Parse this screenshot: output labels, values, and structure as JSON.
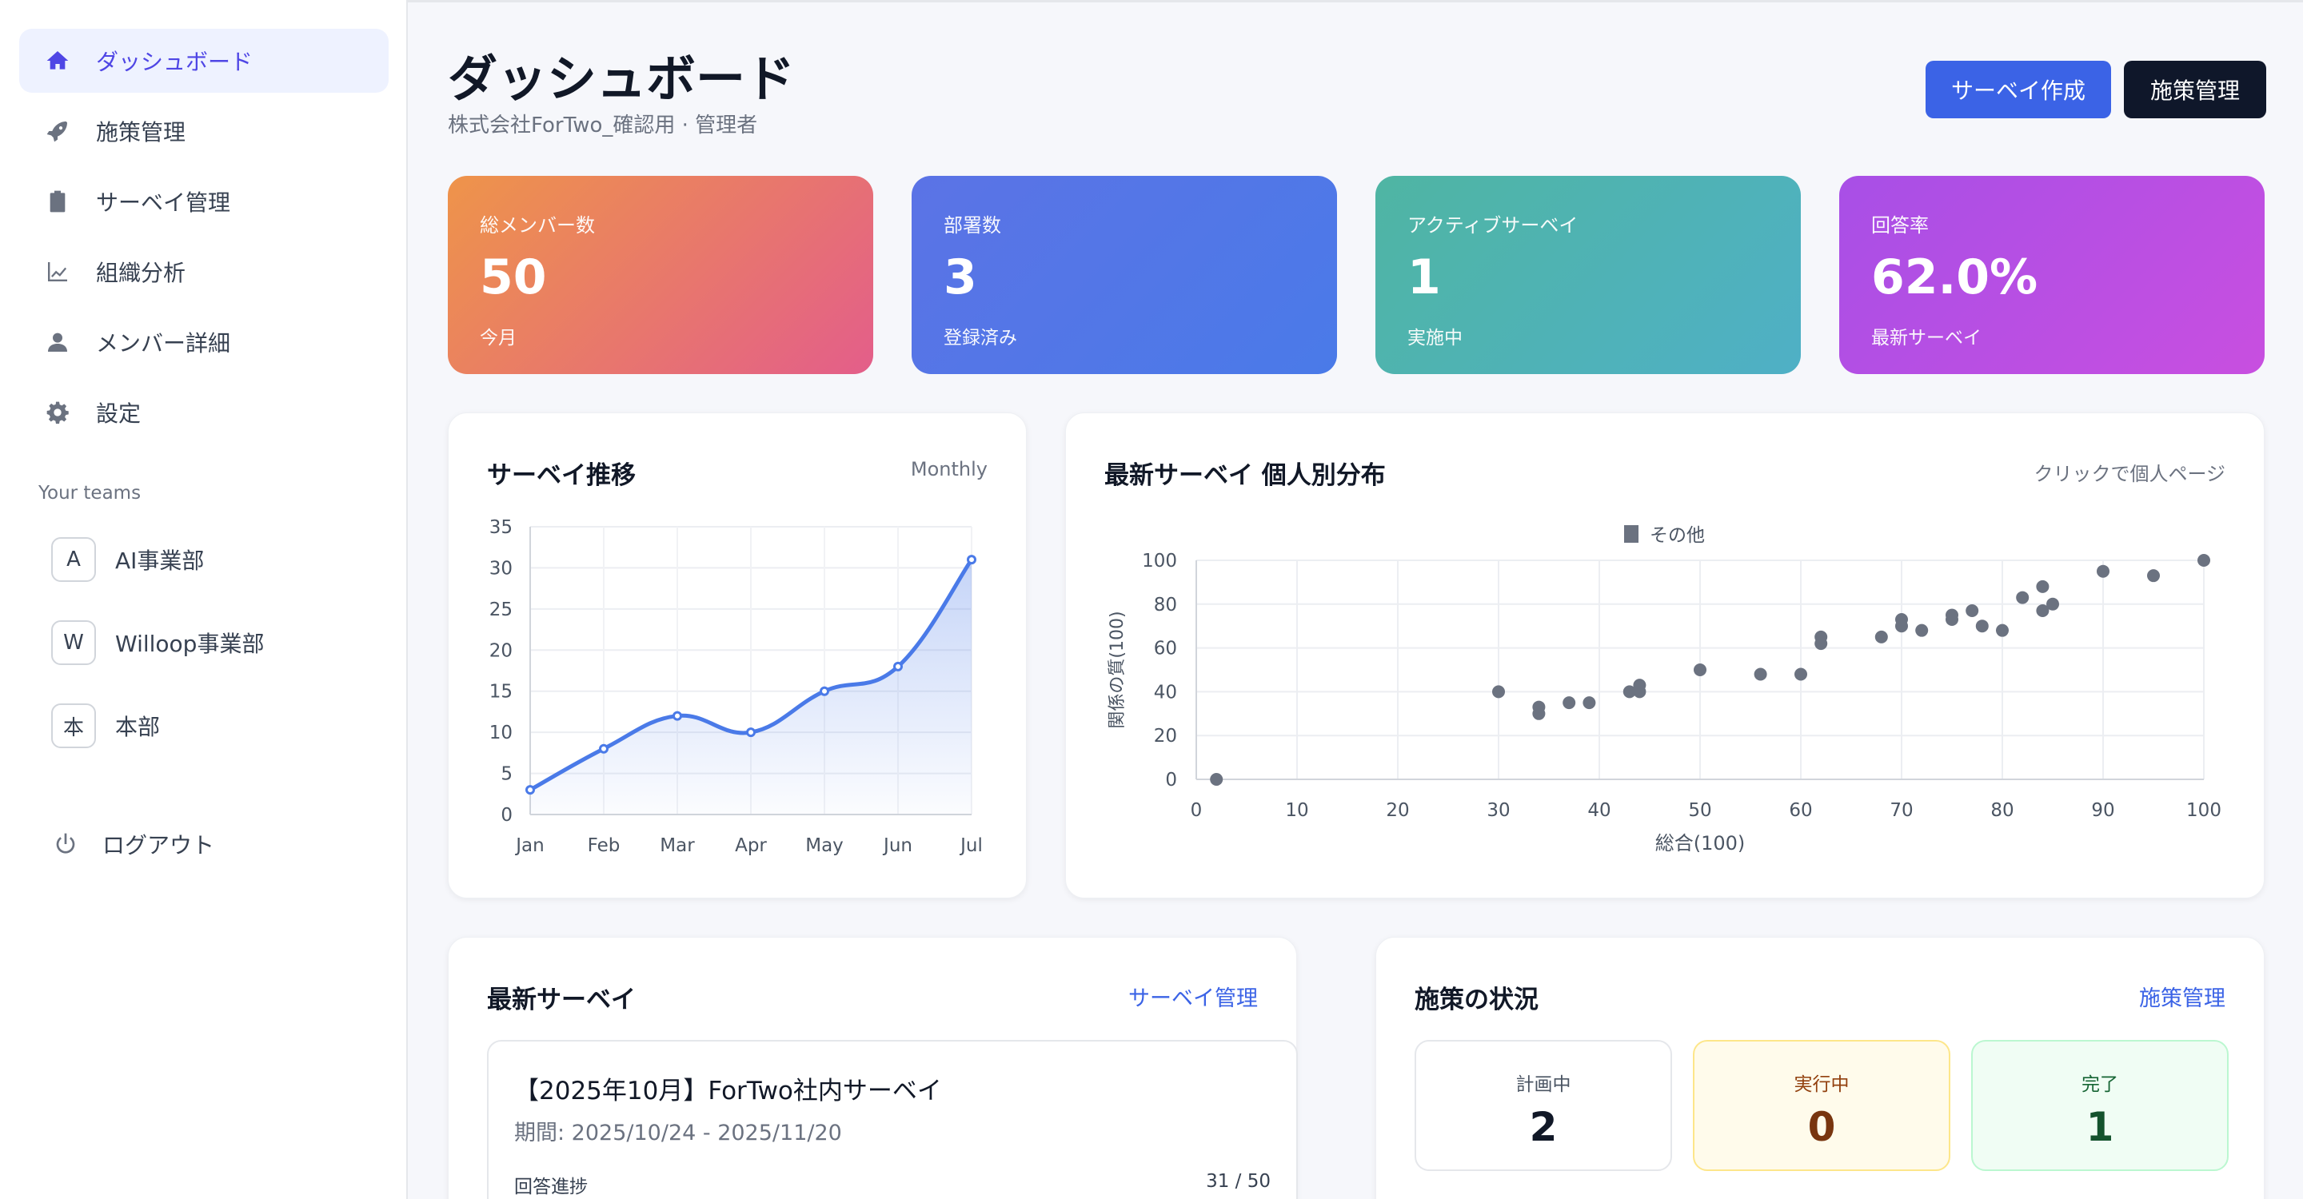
{
  "sidebar": {
    "items": [
      {
        "label": "ダッシュボード",
        "icon": "home-icon"
      },
      {
        "label": "施策管理",
        "icon": "rocket-icon"
      },
      {
        "label": "サーベイ管理",
        "icon": "clipboard-icon"
      },
      {
        "label": "組織分析",
        "icon": "line-chart-icon"
      },
      {
        "label": "メンバー詳細",
        "icon": "user-icon"
      },
      {
        "label": "設定",
        "icon": "gear-icon"
      }
    ],
    "teams_title": "Your teams",
    "teams": [
      {
        "badge": "A",
        "name": "AI事業部"
      },
      {
        "badge": "W",
        "name": "Willoop事業部"
      },
      {
        "badge": "本",
        "name": "本部"
      }
    ],
    "logout_label": "ログアウト"
  },
  "header": {
    "title": "ダッシュボード",
    "subtitle": "株式会社ForTwo_確認用 · 管理者",
    "create_survey_label": "サーベイ作成",
    "measures_label": "施策管理"
  },
  "stats": [
    {
      "label": "総メンバー数",
      "value": "50",
      "sub": "今月"
    },
    {
      "label": "部署数",
      "value": "3",
      "sub": "登録済み"
    },
    {
      "label": "アクティブサーベイ",
      "value": "1",
      "sub": "実施中"
    },
    {
      "label": "回答率",
      "value": "62.0%",
      "sub": "最新サーベイ"
    }
  ],
  "trend_panel": {
    "title": "サーベイ推移",
    "period": "Monthly"
  },
  "scatter_panel": {
    "title": "最新サーベイ 個人別分布",
    "hint": "クリックで個人ページ"
  },
  "survey_panel": {
    "title": "最新サーベイ",
    "link": "サーベイ管理",
    "survey_name": "【2025年10月】ForTwo社内サーベイ",
    "period": "期間: 2025/10/24 - 2025/11/20",
    "progress_label": "回答進捗",
    "progress_count": "31 / 50",
    "progress_fraction": 0.62
  },
  "status_panel": {
    "title": "施策の状況",
    "link": "施策管理",
    "boxes": [
      {
        "label": "計画中",
        "value": "2"
      },
      {
        "label": "実行中",
        "value": "0"
      },
      {
        "label": "完了",
        "value": "1"
      }
    ]
  },
  "chart_data": [
    {
      "type": "line",
      "title": "サーベイ推移",
      "categories": [
        "Jan",
        "Feb",
        "Mar",
        "Apr",
        "May",
        "Jun",
        "Jul"
      ],
      "values": [
        3,
        8,
        12,
        10,
        15,
        18,
        31
      ],
      "ylim": [
        0,
        35
      ],
      "yticks": [
        "0",
        "5",
        "10",
        "15",
        "20",
        "25",
        "30",
        "35"
      ],
      "grid": true,
      "color": "#4a7ae8"
    },
    {
      "type": "scatter",
      "title": "最新サーベイ 個人別分布",
      "xlabel": "総合(100)",
      "ylabel": "関係の質(100)",
      "xlim": [
        0,
        100
      ],
      "ylim": [
        0,
        100
      ],
      "xticks": [
        "0",
        "10",
        "20",
        "30",
        "40",
        "50",
        "60",
        "70",
        "80",
        "90",
        "100"
      ],
      "yticks": [
        "0",
        "20",
        "40",
        "60",
        "80",
        "100"
      ],
      "legend": "その他",
      "legend_position": "top",
      "grid": true,
      "color": "#6b7280",
      "points": [
        [
          2,
          0
        ],
        [
          30,
          40
        ],
        [
          34,
          30
        ],
        [
          34,
          33
        ],
        [
          37,
          35
        ],
        [
          39,
          35
        ],
        [
          43,
          40
        ],
        [
          44,
          40
        ],
        [
          44,
          43
        ],
        [
          50,
          50
        ],
        [
          56,
          48
        ],
        [
          60,
          48
        ],
        [
          62,
          62
        ],
        [
          62,
          65
        ],
        [
          68,
          65
        ],
        [
          70,
          70
        ],
        [
          70,
          73
        ],
        [
          72,
          68
        ],
        [
          75,
          73
        ],
        [
          75,
          75
        ],
        [
          77,
          77
        ],
        [
          78,
          70
        ],
        [
          80,
          68
        ],
        [
          82,
          83
        ],
        [
          84,
          77
        ],
        [
          84,
          88
        ],
        [
          85,
          80
        ],
        [
          90,
          95
        ],
        [
          95,
          93
        ],
        [
          100,
          100
        ]
      ]
    }
  ]
}
